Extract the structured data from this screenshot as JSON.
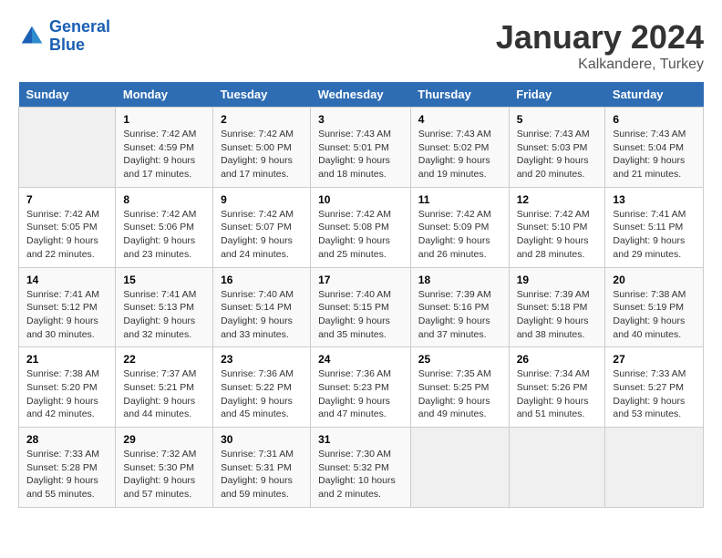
{
  "header": {
    "logo_line1": "General",
    "logo_line2": "Blue",
    "title": "January 2024",
    "subtitle": "Kalkandere, Turkey"
  },
  "columns": [
    "Sunday",
    "Monday",
    "Tuesday",
    "Wednesday",
    "Thursday",
    "Friday",
    "Saturday"
  ],
  "weeks": [
    [
      {
        "day": "",
        "info": ""
      },
      {
        "day": "1",
        "info": "Sunrise: 7:42 AM\nSunset: 4:59 PM\nDaylight: 9 hours\nand 17 minutes."
      },
      {
        "day": "2",
        "info": "Sunrise: 7:42 AM\nSunset: 5:00 PM\nDaylight: 9 hours\nand 17 minutes."
      },
      {
        "day": "3",
        "info": "Sunrise: 7:43 AM\nSunset: 5:01 PM\nDaylight: 9 hours\nand 18 minutes."
      },
      {
        "day": "4",
        "info": "Sunrise: 7:43 AM\nSunset: 5:02 PM\nDaylight: 9 hours\nand 19 minutes."
      },
      {
        "day": "5",
        "info": "Sunrise: 7:43 AM\nSunset: 5:03 PM\nDaylight: 9 hours\nand 20 minutes."
      },
      {
        "day": "6",
        "info": "Sunrise: 7:43 AM\nSunset: 5:04 PM\nDaylight: 9 hours\nand 21 minutes."
      }
    ],
    [
      {
        "day": "7",
        "info": "Sunrise: 7:42 AM\nSunset: 5:05 PM\nDaylight: 9 hours\nand 22 minutes."
      },
      {
        "day": "8",
        "info": "Sunrise: 7:42 AM\nSunset: 5:06 PM\nDaylight: 9 hours\nand 23 minutes."
      },
      {
        "day": "9",
        "info": "Sunrise: 7:42 AM\nSunset: 5:07 PM\nDaylight: 9 hours\nand 24 minutes."
      },
      {
        "day": "10",
        "info": "Sunrise: 7:42 AM\nSunset: 5:08 PM\nDaylight: 9 hours\nand 25 minutes."
      },
      {
        "day": "11",
        "info": "Sunrise: 7:42 AM\nSunset: 5:09 PM\nDaylight: 9 hours\nand 26 minutes."
      },
      {
        "day": "12",
        "info": "Sunrise: 7:42 AM\nSunset: 5:10 PM\nDaylight: 9 hours\nand 28 minutes."
      },
      {
        "day": "13",
        "info": "Sunrise: 7:41 AM\nSunset: 5:11 PM\nDaylight: 9 hours\nand 29 minutes."
      }
    ],
    [
      {
        "day": "14",
        "info": "Sunrise: 7:41 AM\nSunset: 5:12 PM\nDaylight: 9 hours\nand 30 minutes."
      },
      {
        "day": "15",
        "info": "Sunrise: 7:41 AM\nSunset: 5:13 PM\nDaylight: 9 hours\nand 32 minutes."
      },
      {
        "day": "16",
        "info": "Sunrise: 7:40 AM\nSunset: 5:14 PM\nDaylight: 9 hours\nand 33 minutes."
      },
      {
        "day": "17",
        "info": "Sunrise: 7:40 AM\nSunset: 5:15 PM\nDaylight: 9 hours\nand 35 minutes."
      },
      {
        "day": "18",
        "info": "Sunrise: 7:39 AM\nSunset: 5:16 PM\nDaylight: 9 hours\nand 37 minutes."
      },
      {
        "day": "19",
        "info": "Sunrise: 7:39 AM\nSunset: 5:18 PM\nDaylight: 9 hours\nand 38 minutes."
      },
      {
        "day": "20",
        "info": "Sunrise: 7:38 AM\nSunset: 5:19 PM\nDaylight: 9 hours\nand 40 minutes."
      }
    ],
    [
      {
        "day": "21",
        "info": "Sunrise: 7:38 AM\nSunset: 5:20 PM\nDaylight: 9 hours\nand 42 minutes."
      },
      {
        "day": "22",
        "info": "Sunrise: 7:37 AM\nSunset: 5:21 PM\nDaylight: 9 hours\nand 44 minutes."
      },
      {
        "day": "23",
        "info": "Sunrise: 7:36 AM\nSunset: 5:22 PM\nDaylight: 9 hours\nand 45 minutes."
      },
      {
        "day": "24",
        "info": "Sunrise: 7:36 AM\nSunset: 5:23 PM\nDaylight: 9 hours\nand 47 minutes."
      },
      {
        "day": "25",
        "info": "Sunrise: 7:35 AM\nSunset: 5:25 PM\nDaylight: 9 hours\nand 49 minutes."
      },
      {
        "day": "26",
        "info": "Sunrise: 7:34 AM\nSunset: 5:26 PM\nDaylight: 9 hours\nand 51 minutes."
      },
      {
        "day": "27",
        "info": "Sunrise: 7:33 AM\nSunset: 5:27 PM\nDaylight: 9 hours\nand 53 minutes."
      }
    ],
    [
      {
        "day": "28",
        "info": "Sunrise: 7:33 AM\nSunset: 5:28 PM\nDaylight: 9 hours\nand 55 minutes."
      },
      {
        "day": "29",
        "info": "Sunrise: 7:32 AM\nSunset: 5:30 PM\nDaylight: 9 hours\nand 57 minutes."
      },
      {
        "day": "30",
        "info": "Sunrise: 7:31 AM\nSunset: 5:31 PM\nDaylight: 9 hours\nand 59 minutes."
      },
      {
        "day": "31",
        "info": "Sunrise: 7:30 AM\nSunset: 5:32 PM\nDaylight: 10 hours\nand 2 minutes."
      },
      {
        "day": "",
        "info": ""
      },
      {
        "day": "",
        "info": ""
      },
      {
        "day": "",
        "info": ""
      }
    ]
  ]
}
